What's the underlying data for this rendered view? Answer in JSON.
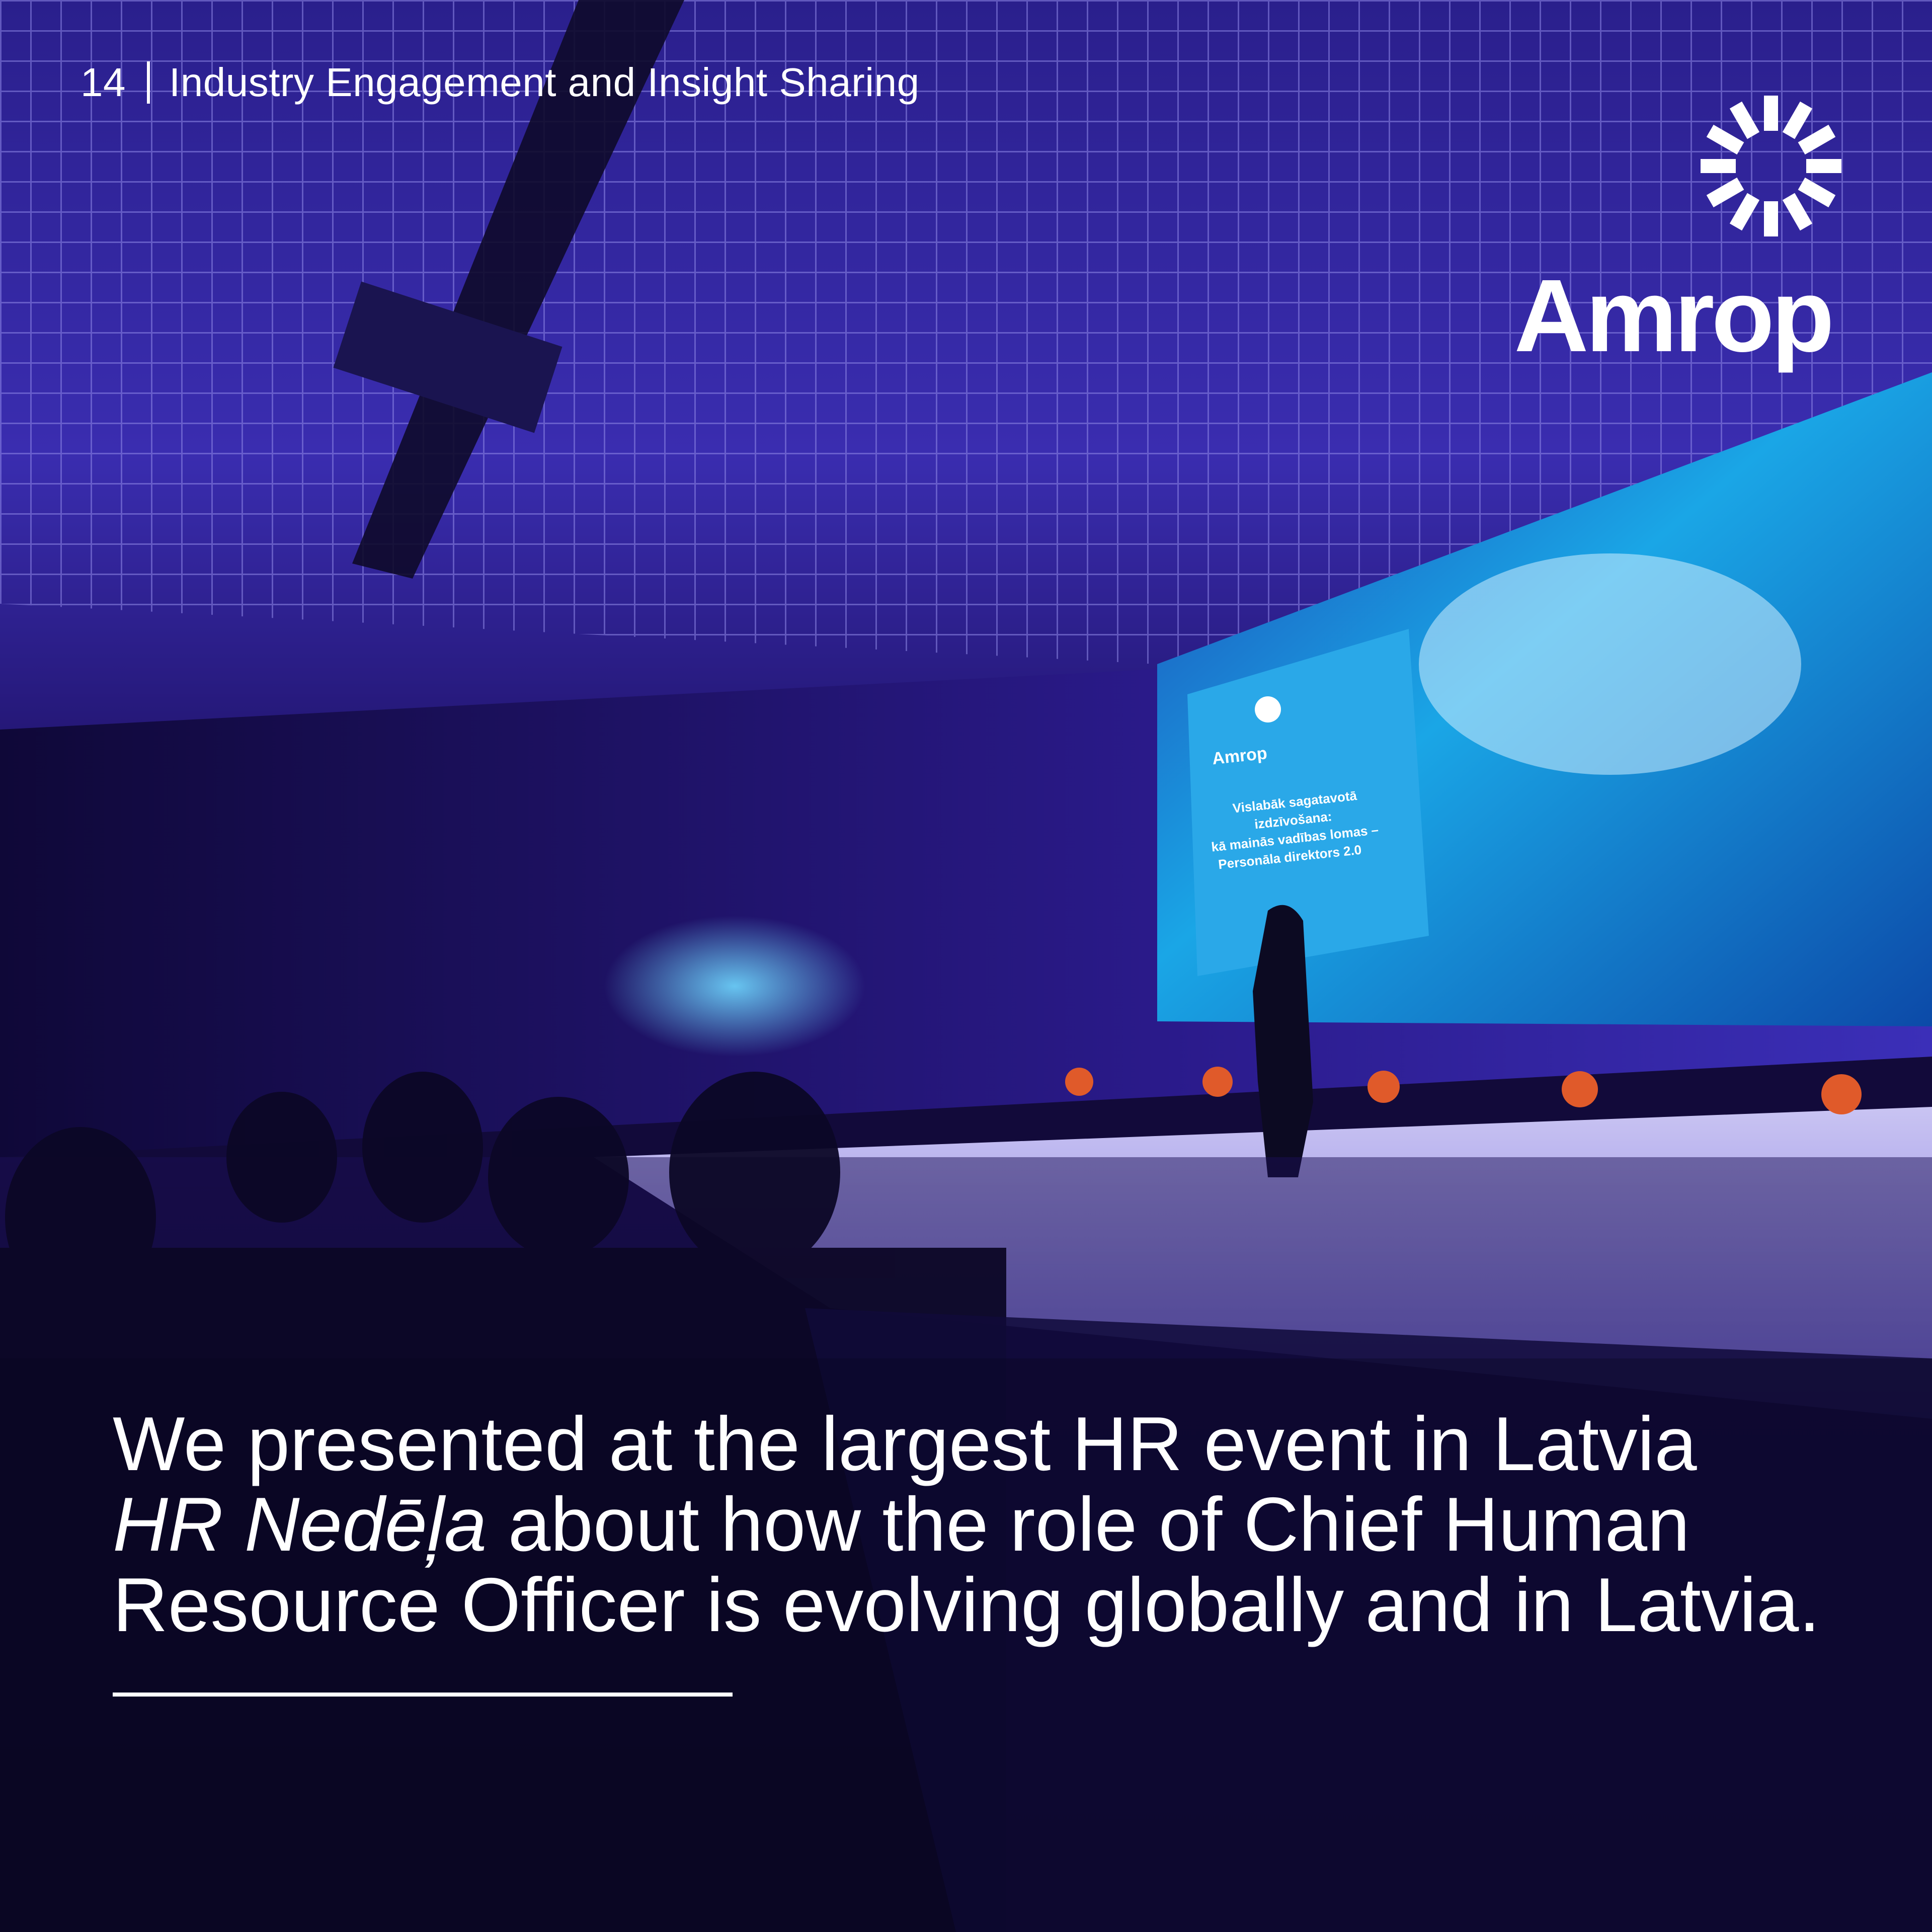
{
  "header": {
    "page_number": "14",
    "section_title": "Industry Engagement and Insight Sharing"
  },
  "logo": {
    "wordmark": "Amrop",
    "mark_icon": "amrop-sunburst-icon"
  },
  "slide_on_screen": {
    "brand": "Amrop",
    "line1": "Vislabāk sagatavotā",
    "line2": "izdzīvošana:",
    "line3": "kā mainās vadības lomas –",
    "line4": "Personāla direktors 2.0"
  },
  "caption": {
    "part1": "We presented at the largest HR event in Latvia ",
    "event_name": "HR Nedēļa",
    "part2": " about how the role of Chief Human Resource Officer is evolving globally and in Latvia."
  },
  "colors": {
    "text": "#ffffff",
    "room_purple": "#2a1a8a",
    "stage_blue": "#3b5bd6",
    "screen_cyan": "#1aa6e6",
    "accent_red": "#e0402a"
  }
}
